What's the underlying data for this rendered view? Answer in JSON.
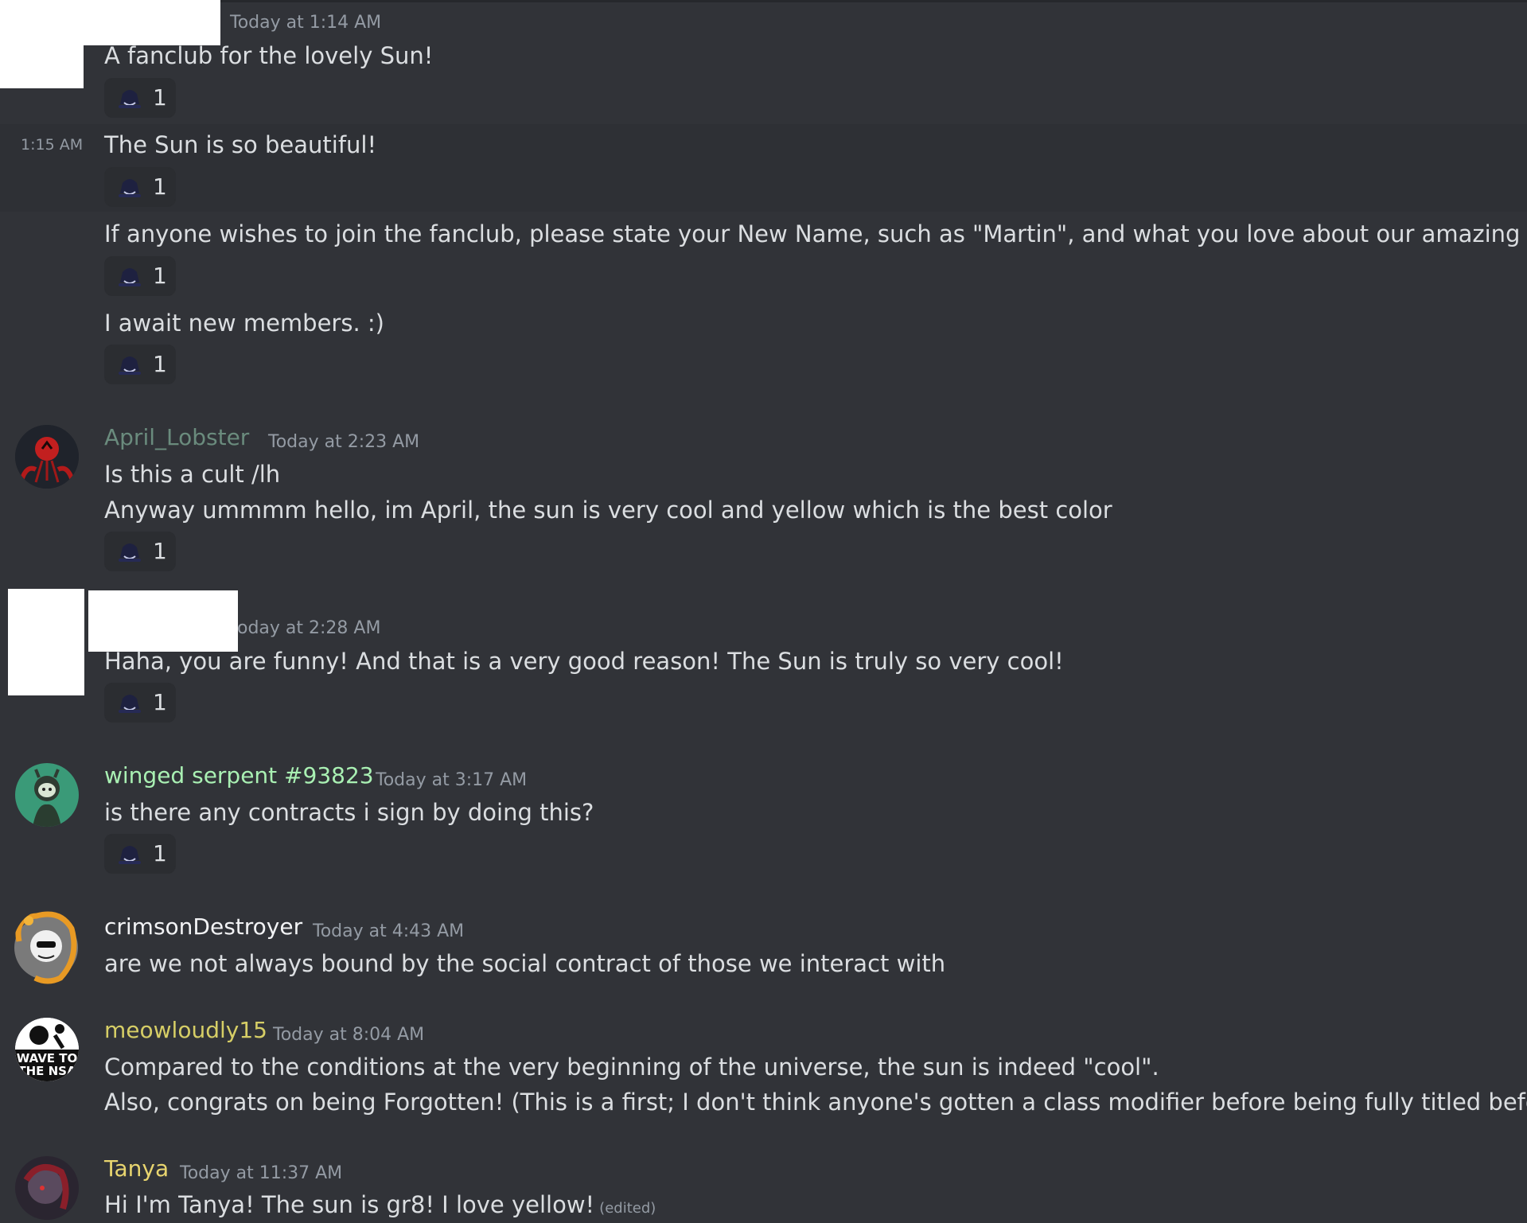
{
  "colors": {
    "background": "#313338",
    "timestamp": "#949ba4",
    "text": "#dbdee1",
    "april": "#6a8b7d",
    "winged": "#a9f0b3",
    "crimson": "#f2f3f5",
    "meow": "#d6ce66",
    "tanya": "#e8d56f"
  },
  "reaction": {
    "icon": "hat-emoji-icon",
    "count": "1"
  },
  "messages": [
    {
      "timestamp": "Today at 1:14 AM",
      "text": "A fanclub for the lovely Sun!"
    },
    {
      "side_time": "1:15 AM",
      "text": "The Sun is so beautiful!"
    },
    {
      "text": "If anyone wishes to join the fanclub, please state your New Name, such as \"Martin\", and what you love about our amazing Sun!"
    },
    {
      "text": "I await new members. :)"
    },
    {
      "author": "April_Lobster",
      "timestamp": "Today at 2:23 AM",
      "lines": [
        "Is this a cult /lh",
        "Anyway ummmm hello, im April, the sun is very cool and yellow which is the best color"
      ]
    },
    {
      "timestamp": "oday at 2:28 AM",
      "text": "Haha, you are funny! And that is a very good reason! The Sun is truly so very cool!"
    },
    {
      "author": "winged serpent #93823",
      "timestamp": "Today at 3:17 AM",
      "text": "is there any contracts i sign by doing this?"
    },
    {
      "author": "crimsonDestroyer",
      "timestamp": "Today at 4:43 AM",
      "text": "are we not always bound by the social contract of those we interact with"
    },
    {
      "author": "meowloudly15",
      "timestamp": "Today at 8:04 AM",
      "avatar_text_1": "WAVE TO",
      "avatar_text_2": "THE NSA",
      "lines": [
        "Compared to the conditions at the very beginning of the universe, the sun is indeed \"cool\".",
        "Also, congrats on being Forgotten! (This is a first; I don't think anyone's gotten a class modifier before being fully titled before)"
      ]
    },
    {
      "author": "Tanya",
      "timestamp": "Today at 11:37 AM",
      "text": "Hi I'm Tanya! The sun is gr8! I love yellow!",
      "edited": "(edited)"
    }
  ]
}
